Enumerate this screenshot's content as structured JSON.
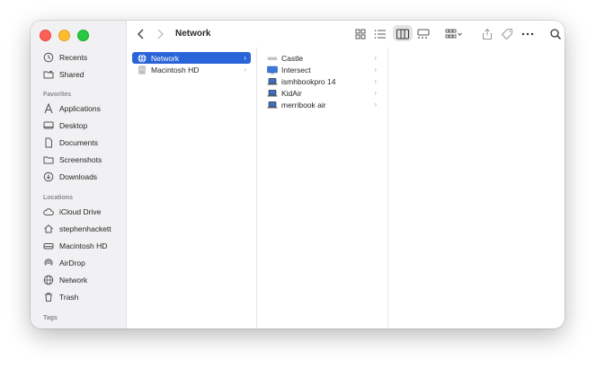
{
  "window": {
    "title": "Network"
  },
  "toolbar": {
    "back_icon": "chevron-left-icon",
    "forward_icon": "chevron-right-icon",
    "views": [
      "icon-view-icon",
      "list-view-icon",
      "column-view-icon",
      "gallery-view-icon"
    ],
    "active_view": "column-view-icon",
    "group_icon": "group-icon",
    "share_icon": "share-icon",
    "tag_icon": "tag-icon",
    "more_icon": "more-icon",
    "search_icon": "search-icon"
  },
  "sidebar": {
    "top_items": [
      {
        "label": "Recents",
        "icon": "clock-icon"
      },
      {
        "label": "Shared",
        "icon": "shared-folder-icon"
      }
    ],
    "favorites_heading": "Favorites",
    "favorites": [
      {
        "label": "Applications",
        "icon": "applications-icon"
      },
      {
        "label": "Desktop",
        "icon": "desktop-icon"
      },
      {
        "label": "Documents",
        "icon": "document-icon"
      },
      {
        "label": "Screenshots",
        "icon": "folder-icon"
      },
      {
        "label": "Downloads",
        "icon": "download-icon"
      }
    ],
    "locations_heading": "Locations",
    "locations": [
      {
        "label": "iCloud Drive",
        "icon": "cloud-icon"
      },
      {
        "label": "stephenhackett",
        "icon": "home-icon"
      },
      {
        "label": "Macintosh HD",
        "icon": "disk-icon"
      },
      {
        "label": "AirDrop",
        "icon": "airdrop-icon"
      },
      {
        "label": "Network",
        "icon": "globe-icon"
      },
      {
        "label": "Trash",
        "icon": "trash-icon"
      }
    ],
    "tags_heading": "Tags"
  },
  "columns": [
    {
      "items": [
        {
          "label": "Network",
          "icon": "globe-icon",
          "selected": true
        },
        {
          "label": "Macintosh HD",
          "icon": "disk-icon",
          "selected": false
        }
      ]
    },
    {
      "items": [
        {
          "label": "Castle",
          "icon": "network-device-icon"
        },
        {
          "label": "Intersect",
          "icon": "monitor-icon"
        },
        {
          "label": "ismhbookpro 14",
          "icon": "laptop-icon"
        },
        {
          "label": "KidAir",
          "icon": "laptop-icon"
        },
        {
          "label": "merribook air",
          "icon": "laptop-icon"
        }
      ]
    }
  ],
  "colors": {
    "selection": "#2a64d9",
    "sidebar_bg": "#f1f1f3"
  }
}
